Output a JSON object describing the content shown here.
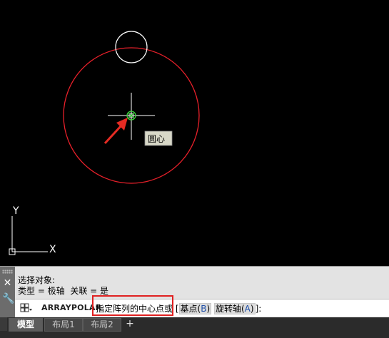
{
  "canvas": {
    "tooltip": "圆心",
    "ucs_y_label": "Y",
    "ucs_x_label": "X"
  },
  "command_panel": {
    "history": [
      "选择对象:",
      "类型 = 极轴  关联 = 是"
    ],
    "command_name": "ARRAYPOLAR",
    "prompt_text": "指定阵列的中心点或 ",
    "option_base_label": "基点",
    "option_base_key": "B",
    "option_axis_label": "旋转轴",
    "option_axis_key": "A",
    "prompt_end": "]:"
  },
  "tabs": [
    {
      "label": "模型",
      "active": true
    },
    {
      "label": "布局1",
      "active": false
    },
    {
      "label": "布局2",
      "active": false
    }
  ],
  "tab_add_label": "+",
  "colors": {
    "background": "#000000",
    "large_circle": "#e8202a",
    "small_circle": "#ffffff",
    "arrow": "#e52b23",
    "snap_marker": "#39d13a",
    "highlight_box": "#e02020"
  },
  "icons": [
    "close-icon",
    "wrench-icon",
    "command-icon",
    "snap-center-icon",
    "ucs-icon"
  ]
}
